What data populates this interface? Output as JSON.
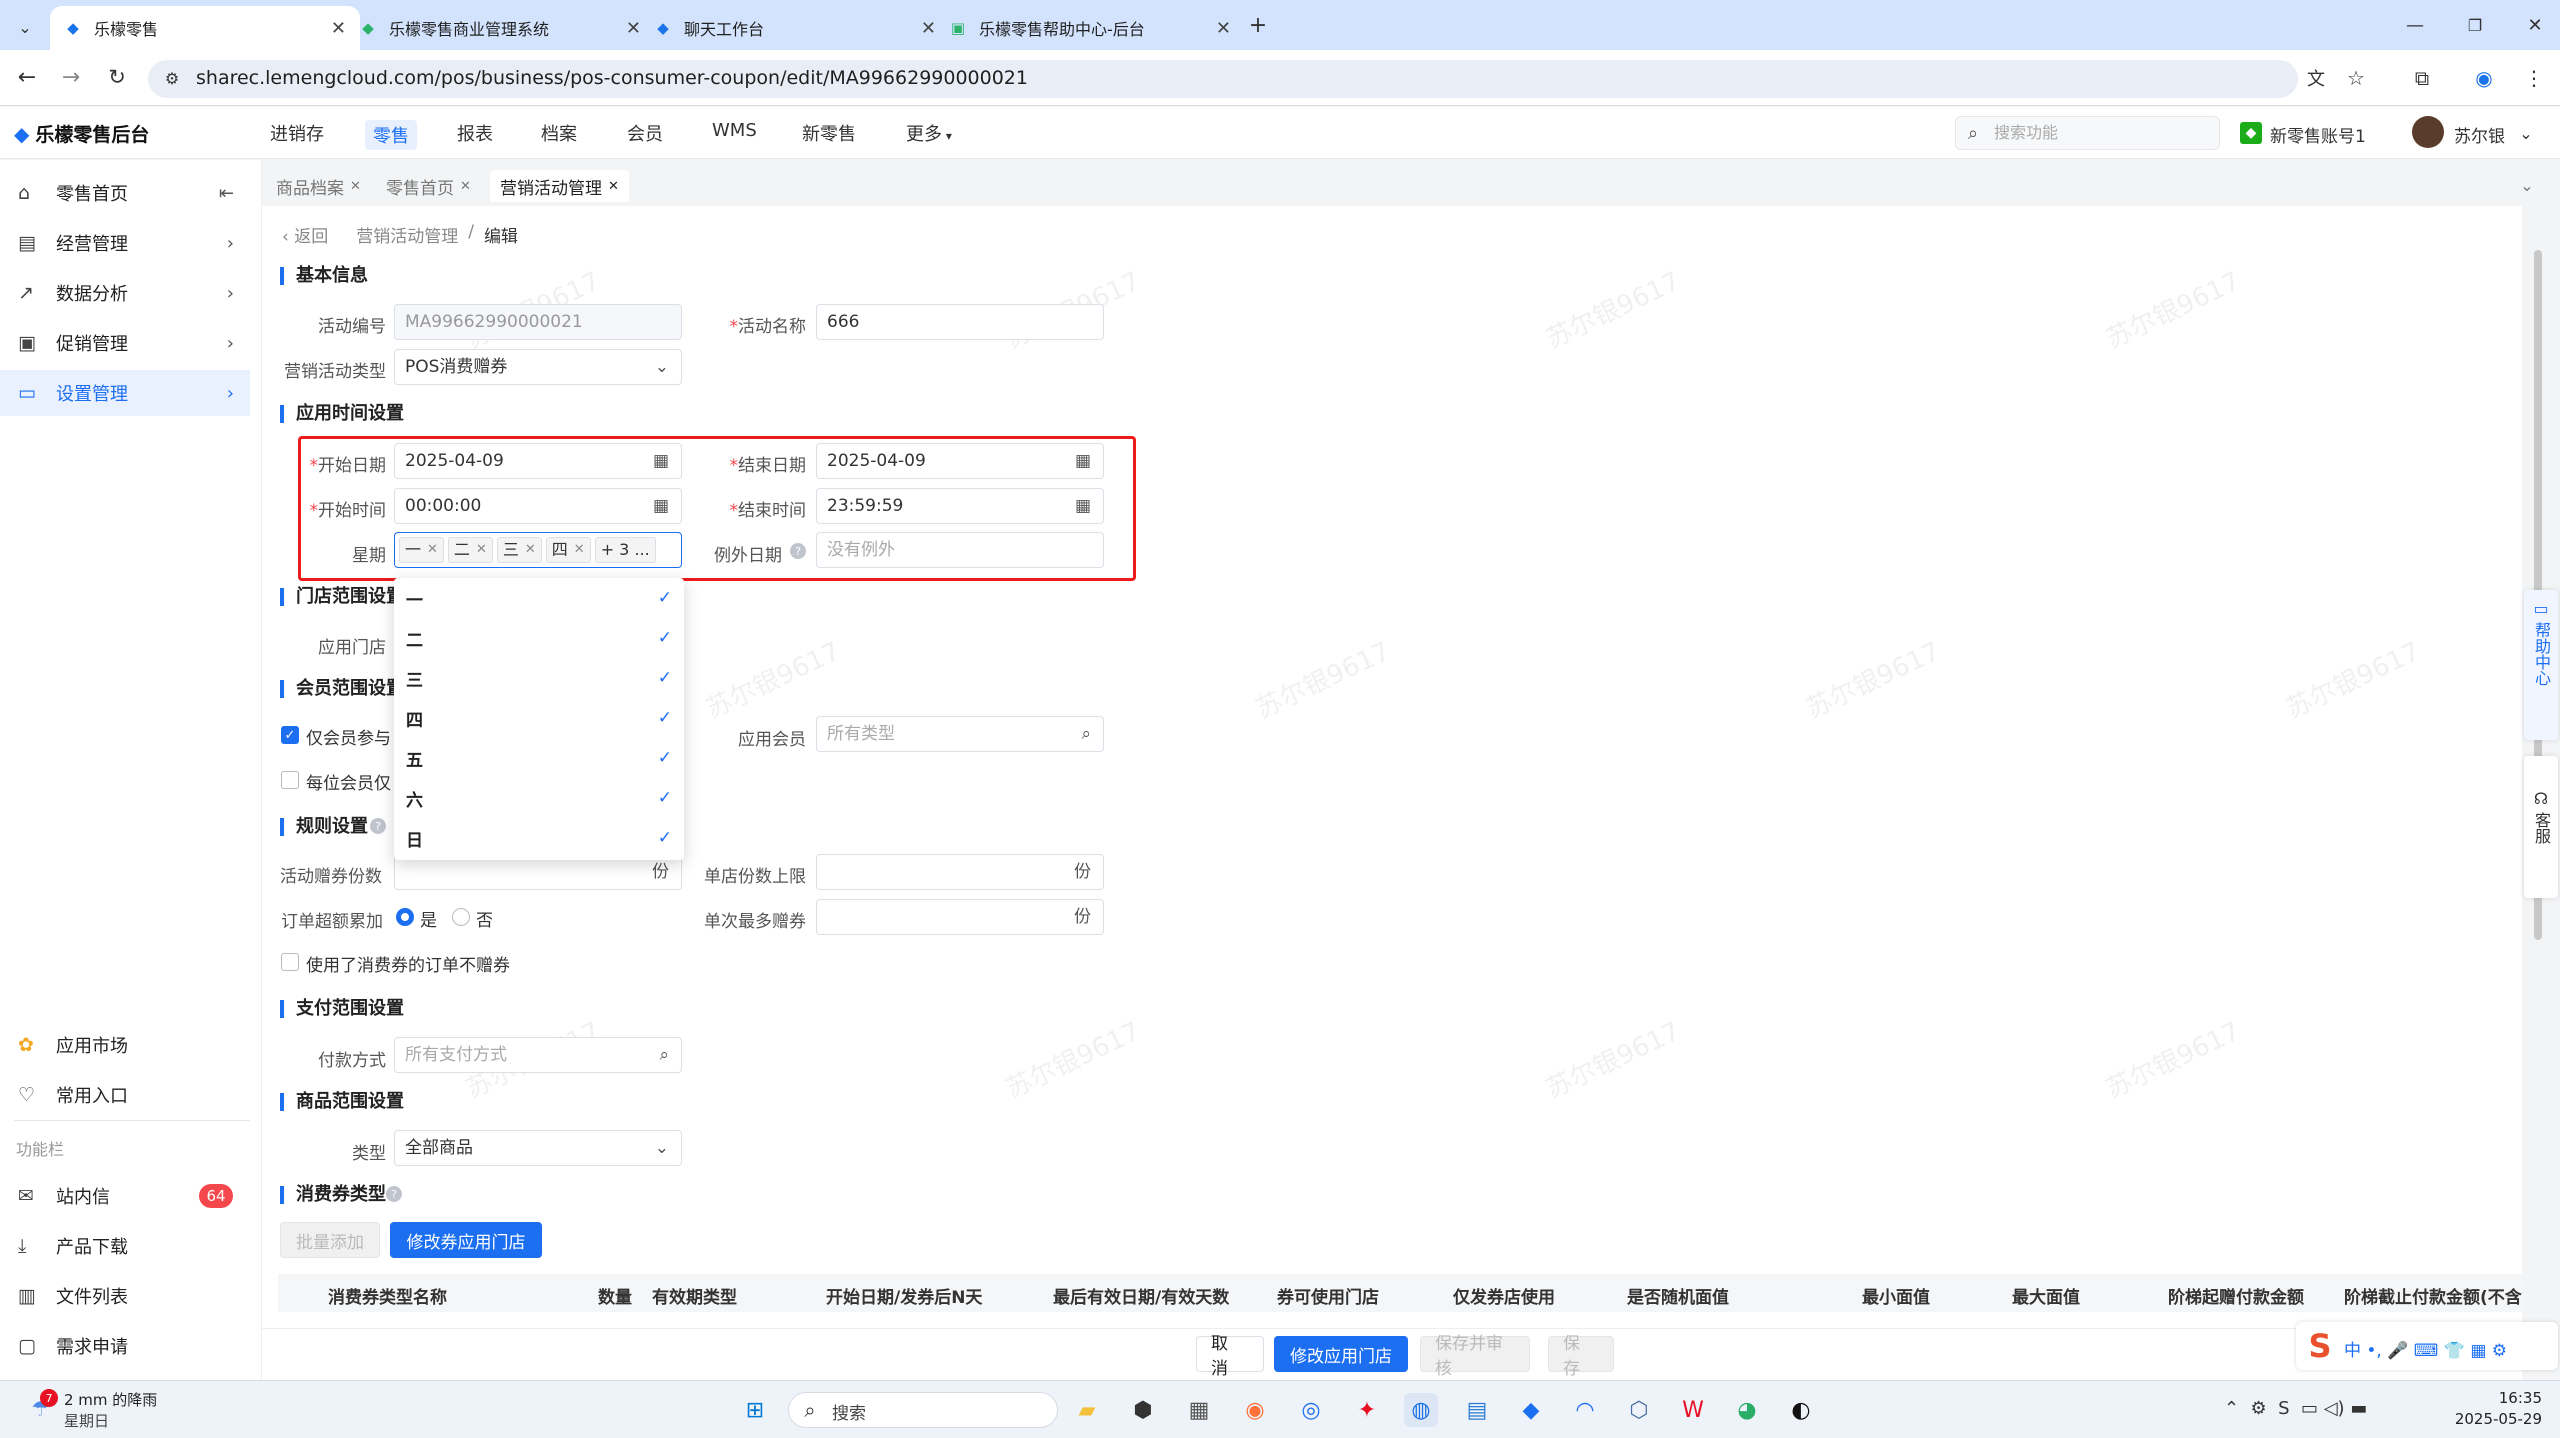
{
  "browser": {
    "tabs": [
      {
        "title": "乐檬零售",
        "active": true
      },
      {
        "title": "乐檬零售商业管理系统",
        "active": false
      },
      {
        "title": "聊天工作台",
        "active": false
      },
      {
        "title": "乐檬零售帮助中心-后台",
        "active": false
      }
    ],
    "url": "sharec.lemengcloud.com/pos/business/pos-consumer-coupon/edit/MA99662990000021"
  },
  "header": {
    "logo": "乐檬零售后台",
    "nav": [
      "进销存",
      "零售",
      "报表",
      "档案",
      "会员",
      "WMS",
      "新零售",
      "更多"
    ],
    "active_nav": "零售",
    "search_placeholder": "搜索功能",
    "account": "新零售账号1",
    "user": "苏尔银"
  },
  "sidebar": {
    "items": [
      {
        "label": "零售首页",
        "icon": "home-icon"
      },
      {
        "label": "经营管理",
        "icon": "chart-board-icon"
      },
      {
        "label": "数据分析",
        "icon": "trend-icon"
      },
      {
        "label": "促销管理",
        "icon": "promo-icon"
      },
      {
        "label": "设置管理",
        "icon": "folder-icon"
      }
    ],
    "bottom": [
      {
        "label": "应用市场",
        "icon": "app-market-icon"
      },
      {
        "label": "常用入口",
        "icon": "heart-icon"
      }
    ],
    "section_label": "功能栏",
    "tools": [
      {
        "label": "站内信",
        "icon": "mail-icon"
      },
      {
        "label": "产品下载",
        "icon": "download-icon"
      },
      {
        "label": "文件列表",
        "icon": "file-list-icon"
      },
      {
        "label": "需求申请",
        "icon": "request-icon"
      }
    ],
    "message_count": "64"
  },
  "page_tabs": [
    "商品档案",
    "零售首页",
    "营销活动管理"
  ],
  "breadcrumb": {
    "back": "返回",
    "parent": "营销活动管理",
    "current": "编辑"
  },
  "form": {
    "basic_title": "基本信息",
    "activity_no_label": "活动编号",
    "activity_no": "MA99662990000021",
    "activity_name_label": "活动名称",
    "activity_name": "666",
    "type_label": "营销活动类型",
    "type_value": "POS消费赠券",
    "time_title": "应用时间设置",
    "start_date_label": "开始日期",
    "start_date": "2025-04-09",
    "end_date_label": "结束日期",
    "end_date": "2025-04-09",
    "start_time_label": "开始时间",
    "start_time": "00:00:00",
    "end_time_label": "结束时间",
    "end_time": "23:59:59",
    "week_label": "星期",
    "week_tags": [
      "一",
      "二",
      "三",
      "四"
    ],
    "week_more": "+ 3 ...",
    "except_label": "例外日期",
    "except_placeholder": "没有例外",
    "store_title": "门店范围设置",
    "store_label": "应用门店",
    "member_title": "会员范围设置",
    "member_only": "仅会员参与",
    "member_apply_label": "应用会员",
    "member_placeholder": "所有类型",
    "per_member": "每位会员仅",
    "rule_title": "规则设置",
    "gift_count_label": "活动赠券份数",
    "unit": "份",
    "store_limit_label": "单店份数上限",
    "overflow_label": "订单超额累加",
    "yes": "是",
    "no": "否",
    "max_once_label": "单次最多赠券",
    "used_coupon_label": "使用了消费券的订单不赠券",
    "pay_title": "支付范围设置",
    "pay_label": "付款方式",
    "pay_placeholder": "所有支付方式",
    "goods_title": "商品范围设置",
    "goods_type_label": "类型",
    "goods_type": "全部商品",
    "coupon_title": "消费券类型",
    "batch_add": "批量添加",
    "modify_store": "修改券应用门店"
  },
  "week_dropdown": [
    "一",
    "二",
    "三",
    "四",
    "五",
    "六",
    "日"
  ],
  "table_headers": [
    "消费券类型名称",
    "数量",
    "有效期类型",
    "开始日期/发券后N天",
    "最后有效日期/有效天数",
    "券可使用门店",
    "仅发券店使用",
    "是否随机面值",
    "最小面值",
    "最大面值",
    "阶梯起赠付款金额",
    "阶梯截止付款金额(不含"
  ],
  "footer": {
    "cancel": "取 消",
    "modify": "修改应用门店",
    "save_audit": "保存并审核",
    "save": "保 存"
  },
  "right_float": {
    "help": "帮助中心",
    "service": "客服"
  },
  "watermark": "苏尔银9617",
  "taskbar": {
    "weather": "2 mm 的降雨",
    "weather_sub": "星期日",
    "weather_badge": "7",
    "search": "搜索",
    "time": "16:35",
    "date": "2025-05-29"
  }
}
